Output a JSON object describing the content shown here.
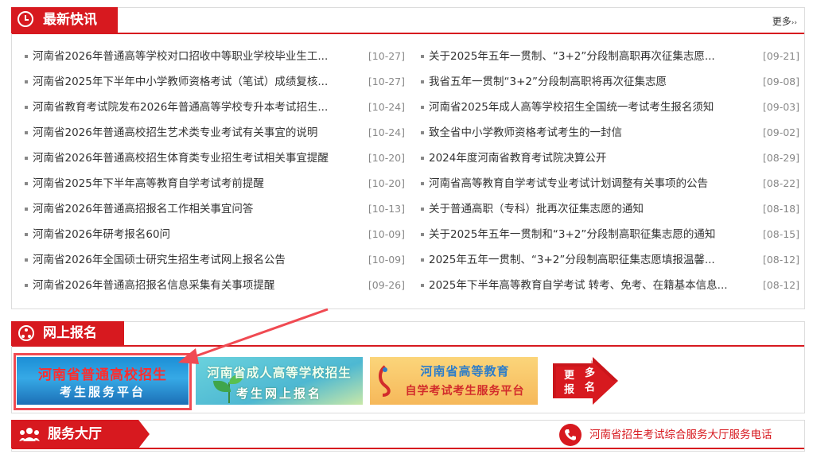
{
  "news": {
    "title": "最新快讯",
    "more": "更多",
    "left": [
      {
        "title": "河南省2026年普通高等学校对口招收中等职业学校毕业生工...",
        "date": "[10-27]"
      },
      {
        "title": "河南省2025年下半年中小学教师资格考试（笔试）成绩复核...",
        "date": "[10-27]"
      },
      {
        "title": "河南省教育考试院发布2026年普通高等学校专升本考试招生...",
        "date": "[10-24]"
      },
      {
        "title": "河南省2026年普通高校招生艺术类专业考试有关事宜的说明",
        "date": "[10-24]"
      },
      {
        "title": "河南省2026年普通高校招生体育类专业招生考试相关事宜提醒",
        "date": "[10-20]"
      },
      {
        "title": "河南省2025年下半年高等教育自学考试考前提醒",
        "date": "[10-20]"
      },
      {
        "title": "河南省2026年普通高招报名工作相关事宜问答",
        "date": "[10-13]"
      },
      {
        "title": "河南省2026年研考报名60问",
        "date": "[10-09]"
      },
      {
        "title": "河南省2026年全国硕士研究生招生考试网上报名公告",
        "date": "[10-09]"
      },
      {
        "title": "河南省2026年普通高招报名信息采集有关事项提醒",
        "date": "[09-26]"
      }
    ],
    "right": [
      {
        "title": "关于2025年五年一贯制、“3+2”分段制高职再次征集志愿...",
        "date": "[09-21]"
      },
      {
        "title": "我省五年一贯制“3+2”分段制高职将再次征集志愿",
        "date": "[09-08]"
      },
      {
        "title": "河南省2025年成人高等学校招生全国统一考试考生报名须知",
        "date": "[09-03]"
      },
      {
        "title": "致全省中小学教师资格考试考生的一封信",
        "date": "[09-02]"
      },
      {
        "title": "2024年度河南省教育考试院决算公开",
        "date": "[08-29]"
      },
      {
        "title": "河南省高等教育自学考试专业考试计划调整有关事项的公告",
        "date": "[08-22]"
      },
      {
        "title": "关于普通高职（专科）批再次征集志愿的通知",
        "date": "[08-18]"
      },
      {
        "title": "关于2025年五年一贯制和“3+2”分段制高职征集志愿的通知",
        "date": "[08-15]"
      },
      {
        "title": "2025年五年一贯制、“3+2”分段制高职征集志愿填报温馨...",
        "date": "[08-12]"
      },
      {
        "title": "2025年下半年高等教育自学考试 转考、免考、在籍基本信息...",
        "date": "[08-12]"
      }
    ]
  },
  "registration": {
    "title": "网上报名",
    "banner1": {
      "line1": "河南省普通高校招生",
      "line2": "考生服务平台"
    },
    "banner2": {
      "line1": "河南省成人高等学校招生",
      "line2": "考生网上报名"
    },
    "banner3": {
      "line1": "河南省高等教育",
      "line2": "自学考试考生服务平台"
    },
    "more": {
      "c1": "更",
      "c2": "多",
      "c3": "报",
      "c4": "名"
    }
  },
  "service": {
    "title": "服务大厅",
    "phone_text": "河南省招生考试综合服务大厅服务电话"
  },
  "colors": {
    "accent": "#d7191f",
    "highlight_frame": "#f04a52"
  }
}
